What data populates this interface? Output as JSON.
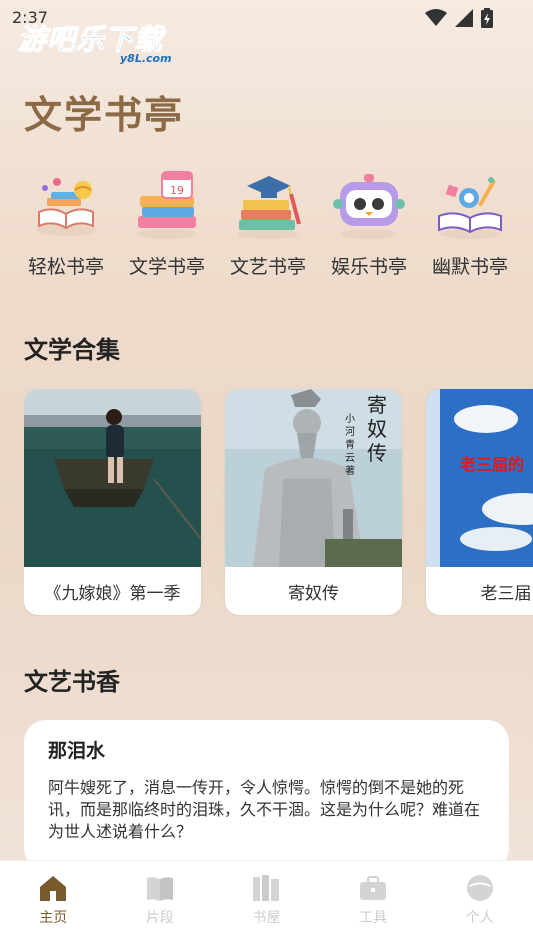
{
  "status_bar": {
    "time": "2:37"
  },
  "watermark": {
    "main": "游吧乐下载",
    "sub": "y8L.com"
  },
  "page_title": "文学书亭",
  "categories": [
    {
      "label": "轻松书亭",
      "icon": "books-globe-icon"
    },
    {
      "label": "文学书亭",
      "icon": "book-stack-calendar-icon"
    },
    {
      "label": "文艺书亭",
      "icon": "graduation-books-icon"
    },
    {
      "label": "娱乐书亭",
      "icon": "robot-icon"
    },
    {
      "label": "幽默书亭",
      "icon": "open-book-tools-icon"
    }
  ],
  "collection": {
    "title": "文学合集",
    "items": [
      {
        "title": "《九嫁娘》第一季"
      },
      {
        "title": "寄奴传",
        "cover_title": "寄奴传",
        "cover_author": "小河青云著"
      },
      {
        "title": "老三届的",
        "cover_title": "老三届的"
      }
    ]
  },
  "literary": {
    "title": "文艺书香",
    "article": {
      "title": "那泪水",
      "body": "阿牛嫂死了，消息一传开，令人惊愕。惊愕的倒不是她的死讯，而是那临终时的泪珠，久不干涸。这是为什么呢？难道在为世人述说着什么？"
    }
  },
  "tabbar": [
    {
      "label": "主页",
      "icon": "home-icon",
      "active": true
    },
    {
      "label": "片段",
      "icon": "open-book-icon",
      "active": false
    },
    {
      "label": "书屋",
      "icon": "bookshelf-icon",
      "active": false
    },
    {
      "label": "工具",
      "icon": "toolbox-icon",
      "active": false
    },
    {
      "label": "个人",
      "icon": "profile-icon",
      "active": false
    }
  ],
  "colors": {
    "accent": "#7a5a2d",
    "title": "#8b6a45",
    "inactive": "#cccccc"
  }
}
